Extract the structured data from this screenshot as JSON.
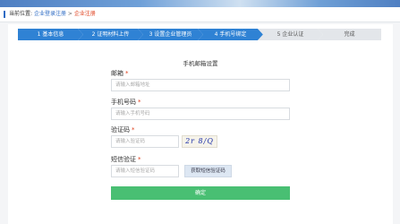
{
  "breadcrumb": {
    "prefix": "当前位置:",
    "item1": "企业登录注册",
    "separator": ">",
    "current": "企业注册"
  },
  "steps": [
    {
      "label": "1 基本信息",
      "state": "done"
    },
    {
      "label": "2 证明材料上传",
      "state": "done"
    },
    {
      "label": "3 设置企业管理员",
      "state": "done"
    },
    {
      "label": "4 手机号绑定",
      "state": "done"
    },
    {
      "label": "5 企业认证",
      "state": "todo"
    },
    {
      "label": "完成",
      "state": "todo"
    }
  ],
  "form": {
    "title": "手机邮箱设置",
    "email_label": "邮箱",
    "email_placeholder": "请输入邮箱地址",
    "phone_label": "手机号码",
    "phone_placeholder": "请输入手机号码",
    "captcha_label": "验证码",
    "captcha_placeholder": "请输入验证码",
    "captcha_image_text": "2r 8/Q",
    "sms_label": "短信验证",
    "sms_placeholder": "请输入短信验证码",
    "sms_button": "获取短信验证码",
    "required_mark": "*",
    "submit": "确定"
  },
  "colors": {
    "primary": "#2f82d4",
    "step_inactive": "#e3e6ea",
    "required": "#e0411e",
    "submit": "#49bf73"
  }
}
